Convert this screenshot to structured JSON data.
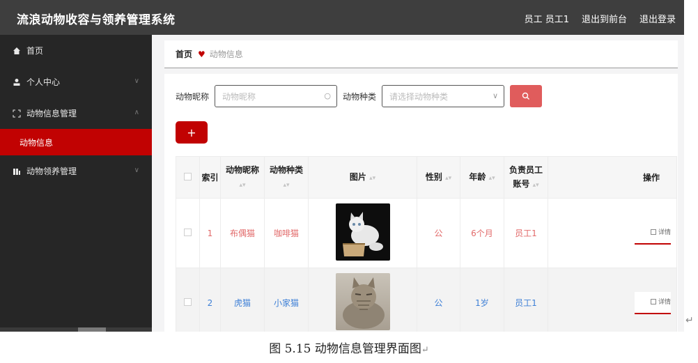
{
  "app": {
    "title": "流浪动物收容与领养管理系统"
  },
  "topbar": {
    "links": [
      "员工 员工1",
      "退出到前台",
      "退出登录"
    ]
  },
  "sidebar": {
    "items": [
      {
        "label": "首页",
        "icon": "home-icon"
      },
      {
        "label": "个人中心",
        "icon": "user-icon"
      },
      {
        "label": "动物信息管理",
        "icon": "frame-icon"
      },
      {
        "label": "动物领养管理",
        "icon": "bars-icon"
      }
    ],
    "active_sub": "动物信息"
  },
  "breadcrumb": {
    "home": "首页",
    "current": "动物信息"
  },
  "search": {
    "name_label": "动物昵称",
    "name_placeholder": "动物昵称",
    "type_label": "动物种类",
    "type_placeholder": "请选择动物种类"
  },
  "add_button": "+",
  "table": {
    "headers": {
      "index": "索引",
      "name": "动物昵称",
      "type": "动物种类",
      "image": "图片",
      "gender": "性别",
      "age": "年龄",
      "staff_line1": "负责员工",
      "staff_line2": "账号",
      "actions": "操作"
    },
    "rows": [
      {
        "index": "1",
        "name": "布偶猫",
        "type": "咖啡猫",
        "gender": "公",
        "age": "6个月",
        "staff": "员工1",
        "action": "详情"
      },
      {
        "index": "2",
        "name": "虎猫",
        "type": "小家猫",
        "gender": "公",
        "age": "1岁",
        "staff": "员工1",
        "action": "详情"
      }
    ]
  },
  "caption": "图 5.15 动物信息管理界面图",
  "caption_mark": "↵",
  "return_mark": "↵",
  "colors": {
    "accent": "#c10202",
    "topbar": "#3e3e3e",
    "sidebar": "#262626",
    "row_text": "#e26a6a",
    "row_text_alt": "#3d7fd6"
  }
}
